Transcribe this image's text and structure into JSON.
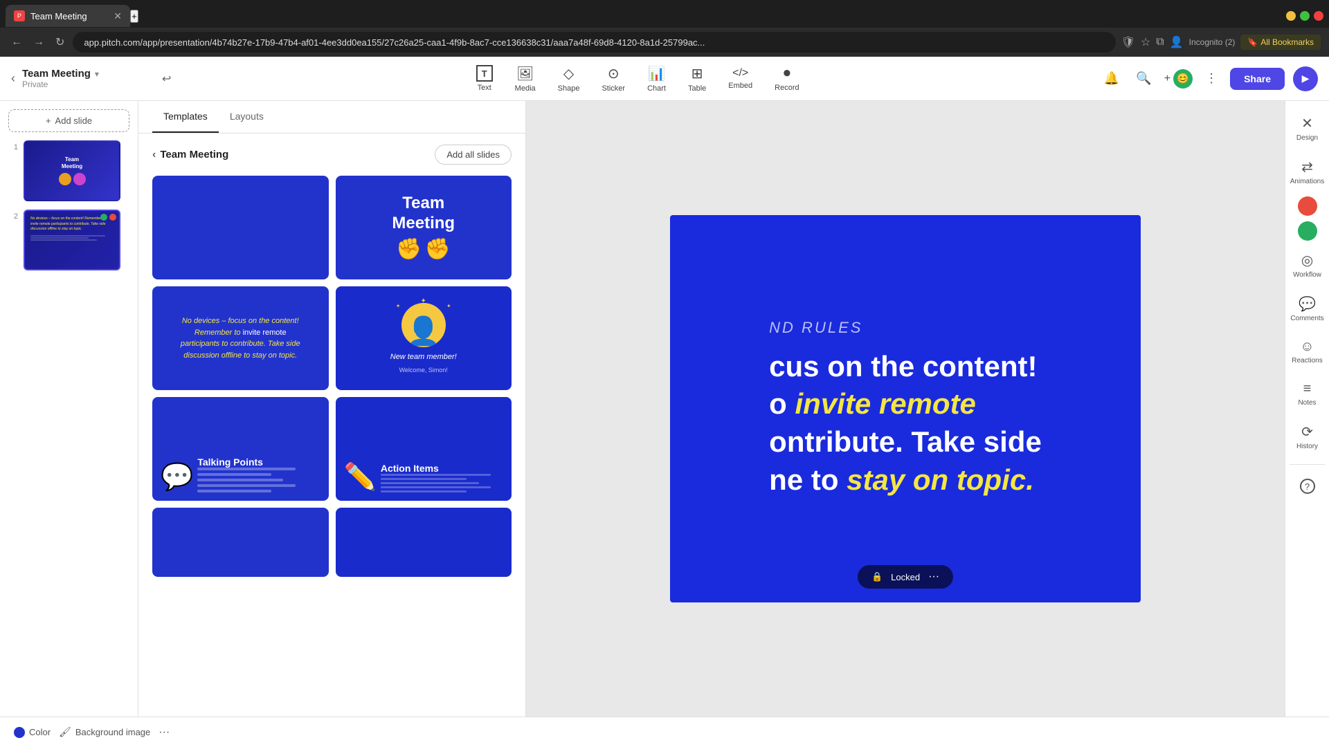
{
  "browser": {
    "tab_title": "Team Meeting",
    "favicon": "P",
    "url": "app.pitch.com/app/presentation/4b74b27e-17b9-47b4-af01-4ee3dd0ea155/27c26a25-caa1-4f9b-8ac7-cce136638c31/aaa7a48f-69d8-4120-8a1d-25799ac...",
    "bookmark_label": "All Bookmarks",
    "incognito_label": "Incognito (2)"
  },
  "toolbar": {
    "presentation_title": "Team Meeting",
    "presentation_private": "Private",
    "undo_icon": "↩",
    "tools": [
      {
        "id": "text",
        "label": "Text",
        "icon": "T"
      },
      {
        "id": "media",
        "label": "Media",
        "icon": "▣"
      },
      {
        "id": "shape",
        "label": "Shape",
        "icon": "◇"
      },
      {
        "id": "sticker",
        "label": "Sticker",
        "icon": "⊙"
      },
      {
        "id": "chart",
        "label": "Chart",
        "icon": "▦"
      },
      {
        "id": "table",
        "label": "Table",
        "icon": "⊞"
      },
      {
        "id": "embed",
        "label": "Embed",
        "icon": "⟨⟩"
      },
      {
        "id": "record",
        "label": "Record",
        "icon": "⏺"
      }
    ],
    "share_label": "Share"
  },
  "slide_panel": {
    "add_slide_label": "Add slide",
    "slides": [
      {
        "number": "1"
      },
      {
        "number": "2"
      }
    ]
  },
  "template_panel": {
    "tabs": [
      "Templates",
      "Layouts"
    ],
    "active_tab": "Templates",
    "header_title": "Team Meeting",
    "add_all_label": "Add all slides",
    "cards": [
      {
        "id": "blank",
        "type": "blank_blue"
      },
      {
        "id": "cover",
        "type": "team_meeting_cover",
        "title": "Team Meeting"
      },
      {
        "id": "rules",
        "type": "rules_text",
        "text_yellow": "No devices",
        "text_white": "– focus on the content! Remember to invite remote participants to contribute. Take side discussion offline to",
        "text_yellow2": "stay on topic."
      },
      {
        "id": "new_member",
        "type": "new_member",
        "label": "New team member!",
        "sublabel": "Welcome, Simon!"
      },
      {
        "id": "talking",
        "type": "talking_points",
        "title": "Talking Points"
      },
      {
        "id": "action",
        "type": "action_items",
        "title": "Action Items"
      },
      {
        "id": "more1",
        "type": "more_blue"
      },
      {
        "id": "more2",
        "type": "more_blue2"
      }
    ]
  },
  "canvas": {
    "subtitle": "ND RULES",
    "body_line1": "cus on the content!",
    "body_line2_normal": "o ",
    "body_line2_highlight": "invite remote",
    "body_line3": "ontribute. Take side",
    "body_line4_normal": "ne to ",
    "body_line4_highlight": "stay on topic.",
    "locked_label": "Locked"
  },
  "right_sidebar": {
    "items": [
      {
        "id": "design",
        "label": "Design",
        "icon": "✕"
      },
      {
        "id": "animations",
        "label": "Animations",
        "icon": "⇄"
      },
      {
        "id": "workflow",
        "label": "Workflow",
        "icon": "◎"
      },
      {
        "id": "comments",
        "label": "Comments",
        "icon": "💬"
      },
      {
        "id": "reactions",
        "label": "Reactions",
        "icon": "☺"
      },
      {
        "id": "notes",
        "label": "Notes",
        "icon": "≡"
      },
      {
        "id": "history",
        "label": "History",
        "icon": "⟳"
      },
      {
        "id": "help",
        "label": "",
        "icon": "?"
      }
    ]
  },
  "bottom_bar": {
    "color_label": "Color",
    "background_label": "Background image"
  }
}
